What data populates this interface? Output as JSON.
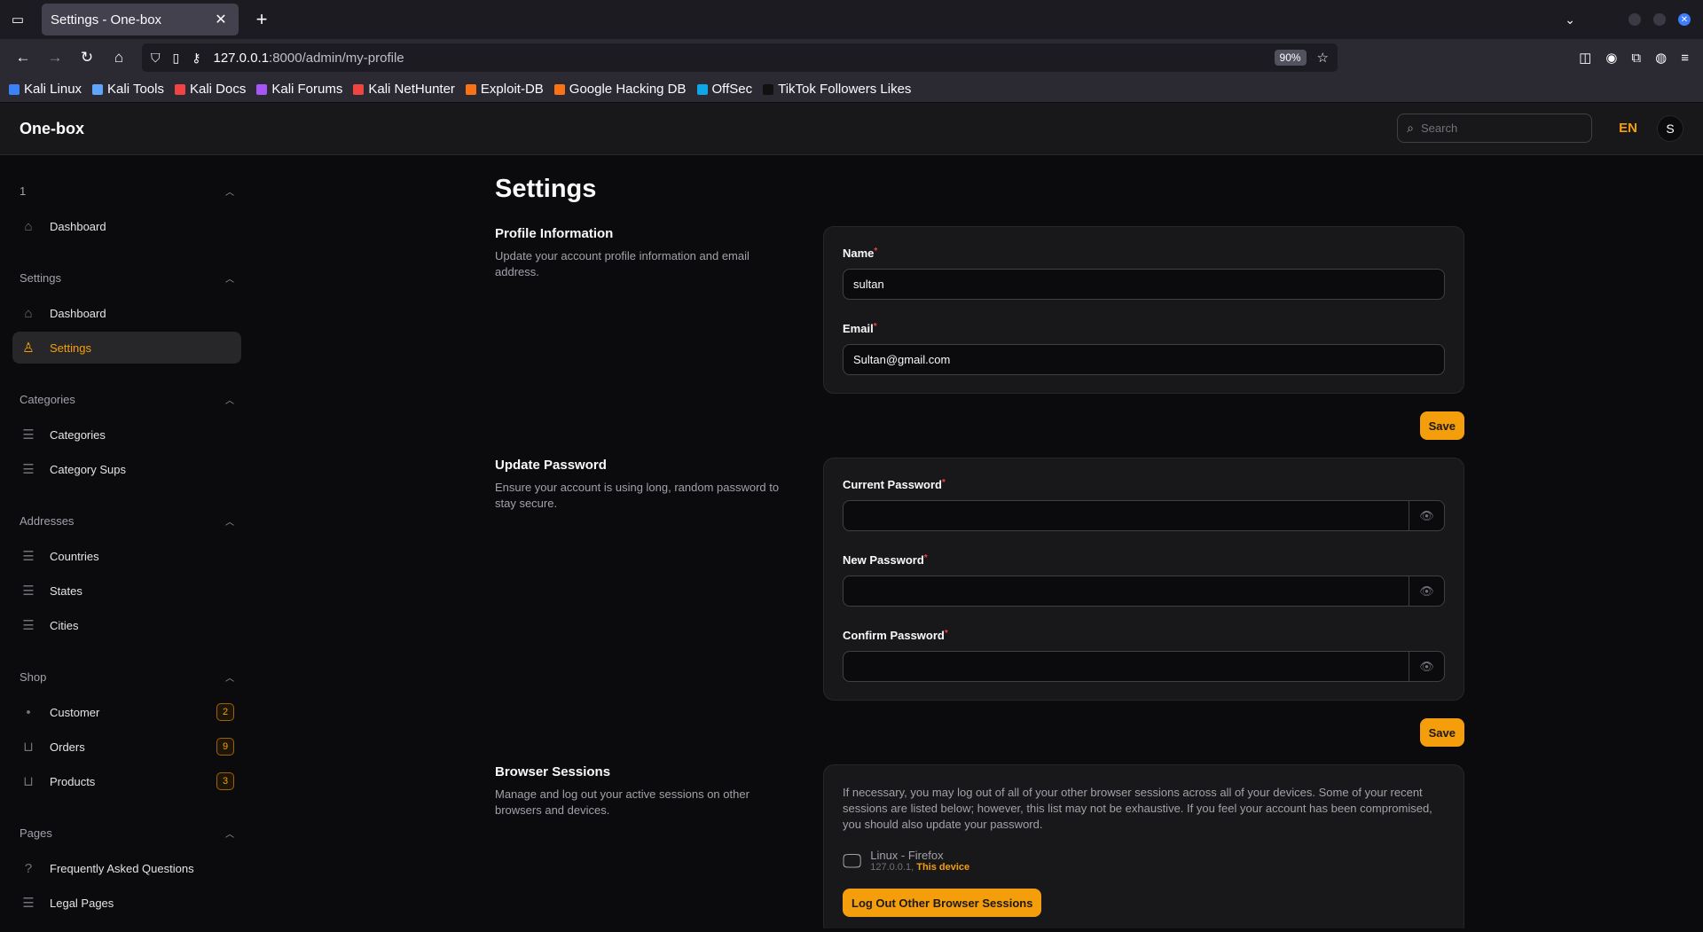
{
  "browser": {
    "tab_title": "Settings - One-box",
    "url_host": "127.0.0.1",
    "url_path": ":8000/admin/my-profile",
    "zoom": "90%",
    "bookmarks": [
      "Kali Linux",
      "Kali Tools",
      "Kali Docs",
      "Kali Forums",
      "Kali NetHunter",
      "Exploit-DB",
      "Google Hacking DB",
      "OffSec",
      "TikTok Followers Likes"
    ]
  },
  "header": {
    "brand": "One-box",
    "search_placeholder": "Search",
    "lang": "EN",
    "avatar": "S"
  },
  "sidebar": {
    "groups": [
      {
        "title": "1",
        "items": [
          {
            "label": "Dashboard",
            "icon": "home-icon"
          }
        ]
      },
      {
        "title": "Settings",
        "items": [
          {
            "label": "Dashboard",
            "icon": "home-icon"
          },
          {
            "label": "Settings",
            "icon": "user-icon",
            "active": true
          }
        ]
      },
      {
        "title": "Categories",
        "items": [
          {
            "label": "Categories",
            "icon": "layers-icon"
          },
          {
            "label": "Category Sups",
            "icon": "layers-icon"
          }
        ]
      },
      {
        "title": "Addresses",
        "items": [
          {
            "label": "Countries",
            "icon": "layers-icon"
          },
          {
            "label": "States",
            "icon": "layers-icon"
          },
          {
            "label": "Cities",
            "icon": "layers-icon"
          }
        ]
      },
      {
        "title": "Shop",
        "items": [
          {
            "label": "Customer",
            "icon": "dot-icon",
            "badge": "2"
          },
          {
            "label": "Orders",
            "icon": "bag-icon",
            "badge": "9"
          },
          {
            "label": "Products",
            "icon": "bag-icon",
            "badge": "3"
          }
        ]
      },
      {
        "title": "Pages",
        "items": [
          {
            "label": "Frequently Asked Questions",
            "icon": "question-icon"
          },
          {
            "label": "Legal Pages",
            "icon": "layers-icon"
          }
        ]
      }
    ]
  },
  "main": {
    "title": "Settings",
    "profile": {
      "heading": "Profile Information",
      "description": "Update your account profile information and email address.",
      "name_label": "Name",
      "name_value": "sultan",
      "email_label": "Email",
      "email_value": "Sultan@gmail.com",
      "save": "Save"
    },
    "password": {
      "heading": "Update Password",
      "description": "Ensure your account is using long, random password to stay secure.",
      "current_label": "Current Password",
      "new_label": "New Password",
      "confirm_label": "Confirm Password",
      "save": "Save"
    },
    "sessions": {
      "heading": "Browser Sessions",
      "description": "Manage and log out your active sessions on other browsers and devices.",
      "text": "If necessary, you may log out of all of your other browser sessions across all of your devices. Some of your recent sessions are listed below; however, this list may not be exhaustive. If you feel your account has been compromised, you should also update your password.",
      "device_name": "Linux - Firefox",
      "device_ip": "127.0.0.1,",
      "device_this": "This device",
      "logout_button": "Log Out Other Browser Sessions"
    }
  }
}
